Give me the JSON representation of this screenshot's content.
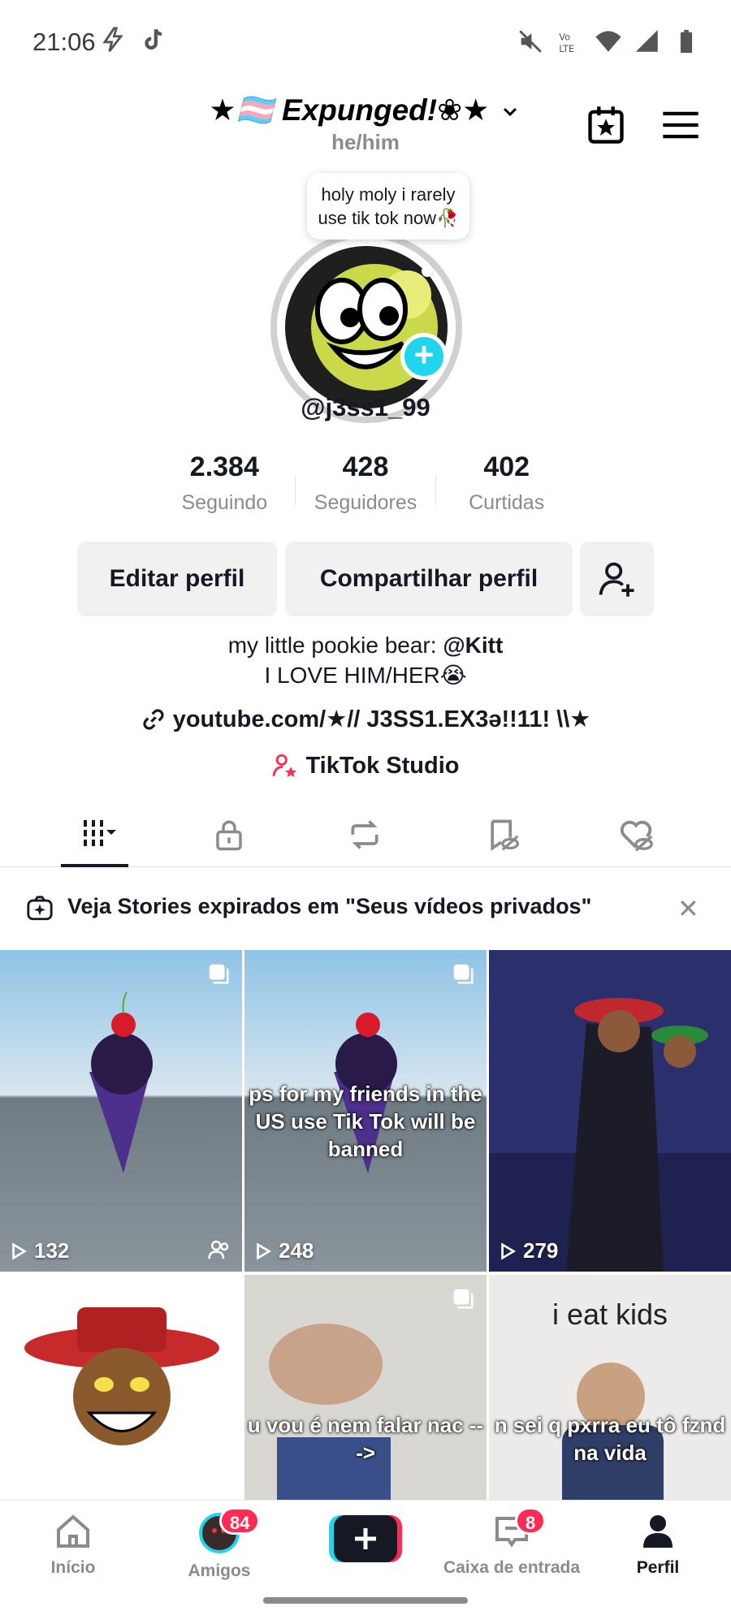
{
  "status_bar": {
    "time": "21:06",
    "left_icons": [
      "flash-notification-icon",
      "tiktok-notification-icon"
    ],
    "right_icons": [
      "mute-icon",
      "volte-icon",
      "wifi-icon",
      "signal-icon",
      "battery-icon"
    ]
  },
  "header": {
    "display_name": "★🏳️‍⚧️ Expunged!❀★",
    "pronouns": "he/him"
  },
  "profile": {
    "note": "holy moly i rarely use tik tok now🥀",
    "username": "@j3ss1_99"
  },
  "stats": [
    {
      "value": "2.384",
      "label": "Seguindo"
    },
    {
      "value": "428",
      "label": "Seguidores"
    },
    {
      "value": "402",
      "label": "Curtidas"
    }
  ],
  "actions": {
    "edit": "Editar perfil",
    "share": "Compartilhar perfil"
  },
  "bio": {
    "line1_prefix": "my little pookie bear: ",
    "line1_mention": "@Kitt",
    "line2": "I LOVE HIM/HER😭",
    "link": "youtube.com/★// J3SS1.EX3ə!!11! \\\\★",
    "studio": "TikTok Studio"
  },
  "tabs": [
    "videos-tab",
    "private-tab",
    "reposts-tab",
    "favorites-tab",
    "liked-tab"
  ],
  "banner": {
    "text": "Veja Stories expirados em \"Seus vídeos privados\""
  },
  "videos": [
    {
      "views": "132",
      "caption": "",
      "friends_only": true
    },
    {
      "views": "248",
      "caption": "ps for my friends in the US use Tik Tok will be banned"
    },
    {
      "views": "279",
      "caption": ""
    },
    {
      "views": "",
      "caption": ""
    },
    {
      "views": "",
      "caption": "u vou é nem falar nac --->"
    },
    {
      "views": "",
      "top_text": "i eat kids",
      "caption": "n sei q pxrra eu tô fznd na vida"
    }
  ],
  "bottom_nav": {
    "home": "Início",
    "friends": "Amigos",
    "friends_badge": "84",
    "inbox": "Caixa de entrada",
    "inbox_badge": "8",
    "profile": "Perfil"
  },
  "colors": {
    "accent_cyan": "#20d5ec",
    "accent_red": "#fe2c55",
    "text_primary": "#161823",
    "text_secondary": "#8a8b91"
  }
}
